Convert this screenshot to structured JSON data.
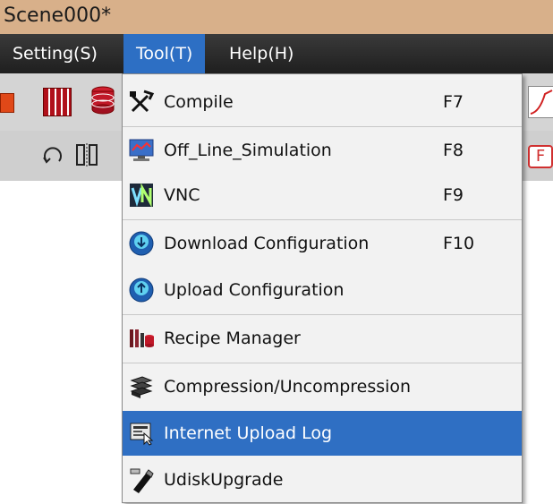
{
  "window": {
    "title": "Scene000*"
  },
  "menubar": {
    "items": [
      {
        "label": "Setting(S)"
      },
      {
        "label": "Tool(T)"
      },
      {
        "label": "Help(H)"
      }
    ]
  },
  "tool_menu": {
    "items": [
      {
        "label": "Compile",
        "shortcut": "F7",
        "icon": "tools-icon"
      },
      {
        "label": "Off_Line_Simulation",
        "shortcut": "F8",
        "icon": "monitor-icon"
      },
      {
        "label": "VNC",
        "shortcut": "F9",
        "icon": "vnc-icon"
      },
      {
        "label": "Download Configuration",
        "shortcut": "F10",
        "icon": "download-icon"
      },
      {
        "label": "Upload Configuration",
        "shortcut": "",
        "icon": "upload-icon"
      },
      {
        "label": "Recipe Manager",
        "shortcut": "",
        "icon": "recipe-icon"
      },
      {
        "label": "Compression/Uncompression",
        "shortcut": "",
        "icon": "compress-icon"
      },
      {
        "label": "Internet Upload Log",
        "shortcut": "",
        "icon": "upload-log-icon",
        "highlighted": true
      },
      {
        "label": "UdiskUpgrade",
        "shortcut": "",
        "icon": "usb-icon"
      }
    ]
  },
  "toolbar": {
    "right_button_label": "F"
  },
  "colors": {
    "titlebar": "#d8b08a",
    "menubar": "#2a2a2a",
    "active_menu": "#2d6fc4",
    "highlight": "#2f6fc3"
  }
}
